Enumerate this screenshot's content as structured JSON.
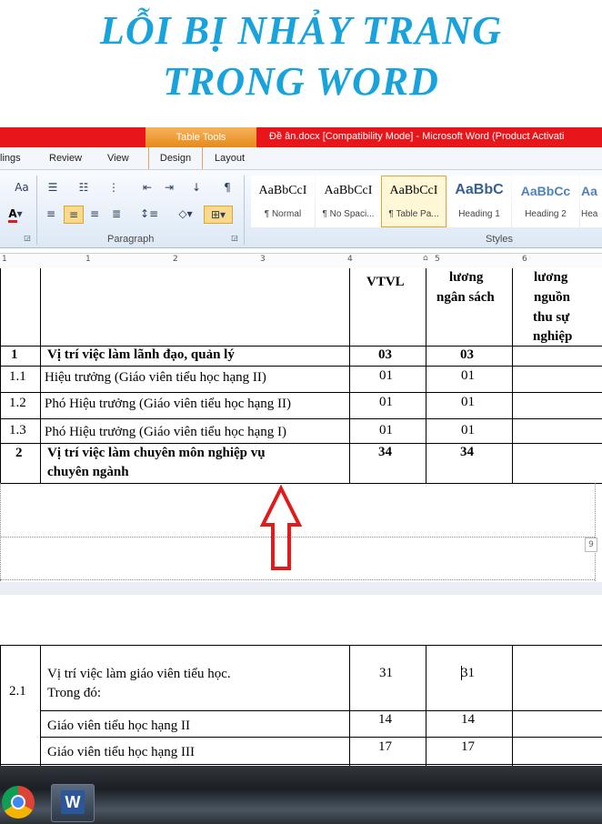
{
  "title": {
    "line1": "LỖI BỊ NHẢY TRANG",
    "line2": "TRONG WORD"
  },
  "window": {
    "title": "Đề ân.docx [Compatibility Mode]  -  Microsoft Word (Product Activati"
  },
  "ribbon": {
    "contextual_tab": "Table Tools",
    "tabs": [
      "lings",
      "Review",
      "View",
      "Design",
      "Layout"
    ],
    "groups": {
      "paragraph": "Paragraph",
      "styles": "Styles"
    },
    "styles": [
      {
        "sample": "AaBbCcI",
        "name": "¶ Normal"
      },
      {
        "sample": "AaBbCcI",
        "name": "¶ No Spaci..."
      },
      {
        "sample": "AaBbCcI",
        "name": "¶ Table Pa..."
      },
      {
        "sample": "AaBbC",
        "name": "Heading 1"
      },
      {
        "sample": "AaBbCc",
        "name": "Heading 2"
      },
      {
        "sample": "Aa",
        "name": "Hea"
      }
    ],
    "icons": [
      "bullets-icon",
      "numbering-icon",
      "multilevel-icon",
      "decrease-indent-icon",
      "increase-indent-icon",
      "sort-icon",
      "show-marks-icon",
      "align-left-icon",
      "align-center-icon",
      "align-right-icon",
      "justify-icon",
      "line-spacing-icon",
      "shading-icon",
      "borders-icon",
      "font-color-icon"
    ]
  },
  "ruler": {
    "numbers": [
      "1",
      "1",
      "2",
      "3",
      "4",
      "5",
      "6"
    ]
  },
  "table_top": {
    "header": {
      "col3": [
        "VTVL"
      ],
      "col4": [
        "lương",
        "ngân sách"
      ],
      "col5": [
        "lương",
        "nguồn",
        "thu sự",
        "nghiệp"
      ]
    },
    "rows": [
      {
        "stt": "1",
        "name": "Vị trí việc làm lãnh đạo, quản lý",
        "c3": "03",
        "c4": "03",
        "bold": true
      },
      {
        "stt": "1.1",
        "name": "Hiệu trưởng (Giáo viên tiểu học hạng II)",
        "c3": "01",
        "c4": "01",
        "bold": false
      },
      {
        "stt": "1.2",
        "name": "Phó Hiệu trưởng (Giáo viên tiểu học hạng II)",
        "c3": "01",
        "c4": "01",
        "bold": false
      },
      {
        "stt": "1.3",
        "name": "Phó Hiệu trưởng (Giáo viên tiểu học hạng I)",
        "c3": "01",
        "c4": "01",
        "bold": false
      },
      {
        "stt": "2",
        "name_line1": "Vị trí việc làm chuyên môn nghiệp vụ",
        "name_line2": "chuyên ngành",
        "c3": "34",
        "c4": "34",
        "bold": true
      }
    ]
  },
  "page_number_badge": "9",
  "table_bottom": {
    "row_21": {
      "stt": "2.1",
      "name_line1": "Vị trí việc làm giáo viên tiểu học.",
      "name_line2": "Trong đó:",
      "c3": "31",
      "c4": "31"
    },
    "rows": [
      {
        "name": "Giáo viên tiểu học hạng II",
        "c3": "14",
        "c4": "14"
      },
      {
        "name": "Giáo viên tiểu học hạng III",
        "c3": "17",
        "c4": "17"
      }
    ]
  },
  "annotation": {
    "arrow_color": "#e01b1b"
  },
  "colors": {
    "title": "#19a3dc",
    "ribbon_red": "#e8151a",
    "table_tools": "#e48a1a"
  }
}
